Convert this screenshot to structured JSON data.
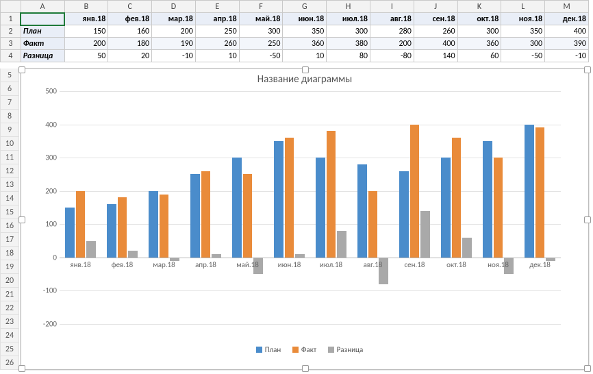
{
  "columns": [
    "A",
    "B",
    "C",
    "D",
    "E",
    "F",
    "G",
    "H",
    "I",
    "J",
    "K",
    "L",
    "M"
  ],
  "months": [
    "янв.18",
    "фев.18",
    "мар.18",
    "апр.18",
    "май.18",
    "июн.18",
    "июл.18",
    "авг.18",
    "сен.18",
    "окт.18",
    "ноя.18",
    "дек.18"
  ],
  "rows": {
    "plan": {
      "label": "План",
      "values": [
        150,
        160,
        200,
        250,
        300,
        350,
        300,
        280,
        260,
        300,
        350,
        400
      ]
    },
    "fact": {
      "label": "Факт",
      "values": [
        200,
        180,
        190,
        260,
        250,
        360,
        380,
        200,
        400,
        360,
        300,
        390
      ]
    },
    "diff": {
      "label": "Разница",
      "values": [
        50,
        20,
        -10,
        10,
        -50,
        10,
        80,
        -80,
        140,
        60,
        -50,
        -10
      ]
    }
  },
  "row_numbers_extra": [
    5,
    6,
    7,
    8,
    9,
    10,
    11,
    12,
    13,
    14,
    15,
    16,
    17,
    18,
    19,
    20,
    21,
    22,
    23,
    24,
    25,
    26
  ],
  "chart_data": {
    "type": "bar",
    "title": "Название диаграммы",
    "categories": [
      "янв.18",
      "фев.18",
      "мар.18",
      "апр.18",
      "май.18",
      "июн.18",
      "июл.18",
      "авг.18",
      "сен.18",
      "окт.18",
      "ноя.18",
      "дек.18"
    ],
    "series": [
      {
        "name": "План",
        "values": [
          150,
          160,
          200,
          250,
          300,
          350,
          300,
          280,
          260,
          300,
          350,
          400
        ],
        "color": "#4a8ccb"
      },
      {
        "name": "Факт",
        "values": [
          200,
          180,
          190,
          260,
          250,
          360,
          380,
          200,
          400,
          360,
          300,
          390
        ],
        "color": "#e98b3a"
      },
      {
        "name": "Разница",
        "values": [
          50,
          20,
          -10,
          10,
          -50,
          10,
          80,
          -80,
          140,
          60,
          -50,
          -10
        ],
        "color": "#a9a9a9"
      }
    ],
    "ylim": [
      -200,
      500
    ],
    "yticks": [
      -200,
      -100,
      0,
      100,
      200,
      300,
      400,
      500
    ],
    "xlabel": "",
    "ylabel": "",
    "legend_position": "bottom"
  }
}
